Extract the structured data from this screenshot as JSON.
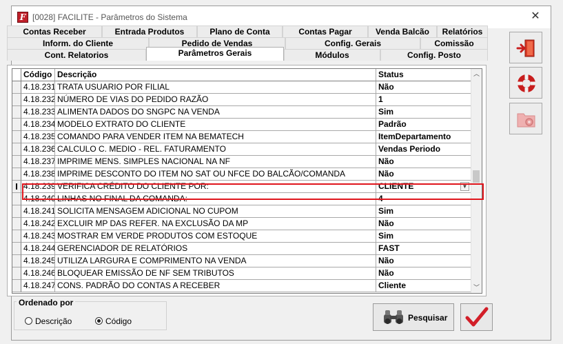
{
  "window": {
    "title": "[0028] FACILITE - Parâmetros do Sistema",
    "app_icon_letter": "F"
  },
  "tabs": {
    "row1": [
      "Contas Receber",
      "Entrada Produtos",
      "Plano de Conta",
      "Contas Pagar",
      "Venda Balcão",
      "Relatórios"
    ],
    "row2": [
      "Inform. do Cliente",
      "Pedido de Vendas",
      "Config. Gerais",
      "Comissão"
    ],
    "row3": [
      "Cont. Relatorios",
      "Parâmetros Gerais",
      "Módulos",
      "Config. Posto"
    ],
    "active": "Parâmetros Gerais"
  },
  "grid": {
    "headers": {
      "code": "Código",
      "description": "Descrição",
      "status": "Status"
    },
    "rows": [
      {
        "code": "4.18.231",
        "description": "TRATA USUARIO POR FILIAL",
        "status": "Não"
      },
      {
        "code": "4.18.232",
        "description": "NÚMERO DE VIAS DO PEDIDO RAZÃO",
        "status": "1"
      },
      {
        "code": "4.18.233",
        "description": "ALIMENTA DADOS DO SNGPC NA VENDA",
        "status": "Sim"
      },
      {
        "code": "4.18.234",
        "description": "MODELO EXTRATO DO CLIENTE",
        "status": "Padrão"
      },
      {
        "code": "4.18.235",
        "description": "COMANDO PARA VENDER ITEM NA BEMATECH",
        "status": "ItemDepartamento"
      },
      {
        "code": "4.18.236",
        "description": "CALCULO C. MEDIO - REL. FATURAMENTO",
        "status": "Vendas Periodo"
      },
      {
        "code": "4.18.237",
        "description": "IMPRIME MENS. SIMPLES NACIONAL NA NF",
        "status": "Não"
      },
      {
        "code": "4.18.238",
        "description": "IMPRIME DESCONTO DO ITEM NO SAT OU NFCE DO BALCÃO/COMANDA",
        "status": "Não"
      },
      {
        "code": "4.18.239",
        "description": "VERIFICA CRÉDITO DO CLIENTE POR:",
        "status": "CLIENTE"
      },
      {
        "code": "4.18.240",
        "description": "LINHAS NO FINAL DA COMANDA:",
        "status": "4"
      },
      {
        "code": "4.18.241",
        "description": "SOLICITA MENSAGEM ADICIONAL NO CUPOM",
        "status": "Sim"
      },
      {
        "code": "4.18.242",
        "description": "EXCLUIR MP DAS REFER. NA EXCLUSÃO DA MP",
        "status": "Não"
      },
      {
        "code": "4.18.243",
        "description": "MOSTRAR EM VERDE PRODUTOS COM ESTOQUE",
        "status": "Sim"
      },
      {
        "code": "4.18.244",
        "description": "GERENCIADOR DE RELATÓRIOS",
        "status": "FAST"
      },
      {
        "code": "4.18.245",
        "description": "UTILIZA LARGURA E COMPRIMENTO NA VENDA",
        "status": "Não"
      },
      {
        "code": "4.18.246",
        "description": "BLOQUEAR EMISSÃO DE NF SEM TRIBUTOS",
        "status": "Não"
      },
      {
        "code": "4.18.247",
        "description": "CONS. PADRÃO DO CONTAS A RECEBER",
        "status": "Cliente"
      }
    ],
    "selected_row": "4.18.239",
    "selected_marker": "I"
  },
  "order": {
    "legend": "Ordenado por",
    "options": [
      "Descrição",
      "Código"
    ],
    "selected": "Código"
  },
  "buttons": {
    "search_label": "Pesquisar"
  },
  "colors": {
    "highlight": "#e0141b",
    "exit": "#d83a26",
    "help": "#c81e1e",
    "config_disabled": "#e8a0a0",
    "ok_check": "#d21e28"
  }
}
